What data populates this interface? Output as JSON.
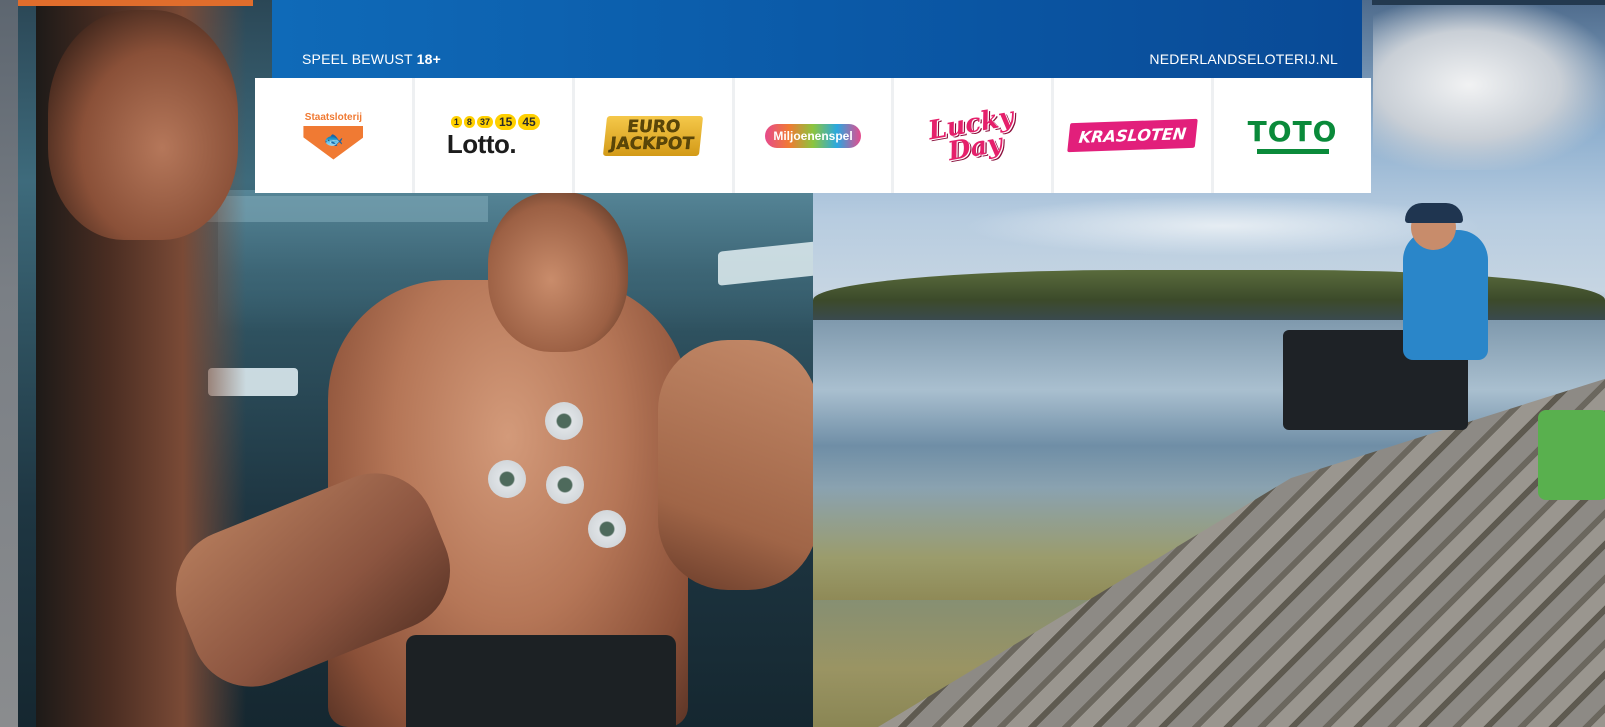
{
  "banner": {
    "left_text_prefix": "SPEEL BEWUST",
    "left_text_age": "18+",
    "right_text": "NEDERLANDSELOTERIJ.NL",
    "bar_color": "#0b5aa8"
  },
  "logos": {
    "staatsloterij": {
      "name": "Staatsloterij",
      "color": "#f07a33",
      "icon": "fish-icon"
    },
    "lotto": {
      "balls": [
        "1",
        "8",
        "37",
        "15",
        "45"
      ],
      "name": "Lotto.",
      "ball_color": "#ffd000"
    },
    "eurojackpot": {
      "line1": "EURO",
      "line2": "JACKPOT"
    },
    "miljoenenspel": {
      "name": "Miljoenenspel"
    },
    "luckyday": {
      "line1": "Lucky",
      "line2": "Day",
      "color": "#e5206b"
    },
    "krasloten": {
      "name": "KRASLOTEN",
      "color": "#e21f7b"
    },
    "toto": {
      "name": "TOTO",
      "color": "#0a8a3a"
    }
  },
  "photos": {
    "left": "gym-athlete-with-ecg-electrodes",
    "right": "angler-fishing-by-lake"
  }
}
